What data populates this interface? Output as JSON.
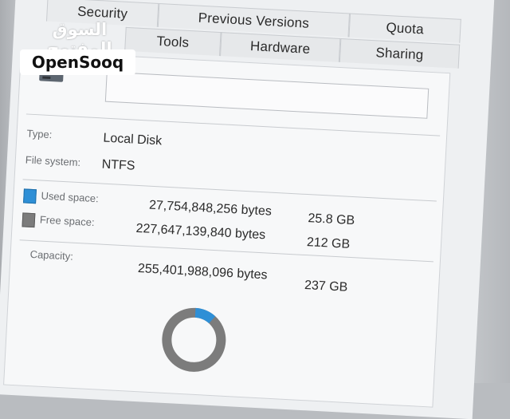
{
  "tabs": {
    "security": "Security",
    "previous_versions": "Previous Versions",
    "quota": "Quota",
    "tools": "Tools",
    "hardware": "Hardware",
    "sharing": "Sharing"
  },
  "general": {
    "type_label": "Type:",
    "type_value": "Local Disk",
    "fs_label": "File system:",
    "fs_value": "NTFS",
    "used_label": "Used space:",
    "used_bytes": "27,754,848,256 bytes",
    "used_gb": "25.8 GB",
    "free_label": "Free space:",
    "free_bytes": "227,647,139,840 bytes",
    "free_gb": "212 GB",
    "capacity_label": "Capacity:",
    "capacity_bytes": "255,401,988,096 bytes",
    "capacity_gb": "237 GB",
    "used_fraction": 0.1087
  },
  "colors": {
    "used": "#2e8fd6",
    "free": "#7c7c7c"
  },
  "watermark": {
    "arabic": "السوق المفتوح",
    "latin": "OpenSooq"
  }
}
